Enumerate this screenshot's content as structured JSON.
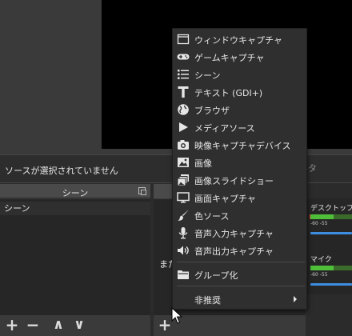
{
  "status_bar": {
    "no_source_text": "ソースが選択されていません",
    "filter_label": "ルタ"
  },
  "scenes_dock": {
    "title": "シーン",
    "items": [
      "シーン"
    ],
    "toolbar": {
      "add": "+",
      "remove": "−",
      "up": "∧",
      "down": "∨"
    }
  },
  "sources_dock": {
    "hint_text": "また",
    "toolbar": {
      "add": "+"
    }
  },
  "mixer": {
    "channels": [
      {
        "name": "デスクトップ音声",
        "ticks": "-60   -55",
        "level": 0.55
      },
      {
        "name": "マイク",
        "ticks": "-60   -55",
        "level": 0.55
      }
    ]
  },
  "context_menu": {
    "items": [
      {
        "label": "ウィンドウキャプチャ",
        "icon": "window-icon"
      },
      {
        "label": "ゲームキャプチャ",
        "icon": "gamepad-icon"
      },
      {
        "label": "シーン",
        "icon": "list-icon"
      },
      {
        "label": "テキスト (GDI+)",
        "icon": "text-icon"
      },
      {
        "label": "ブラウザ",
        "icon": "globe-icon"
      },
      {
        "label": "メディアソース",
        "icon": "play-icon"
      },
      {
        "label": "映像キャプチャデバイス",
        "icon": "camera-icon"
      },
      {
        "label": "画像",
        "icon": "image-icon"
      },
      {
        "label": "画像スライドショー",
        "icon": "slideshow-icon"
      },
      {
        "label": "画面キャプチャ",
        "icon": "monitor-icon"
      },
      {
        "label": "色ソース",
        "icon": "brush-icon"
      },
      {
        "label": "音声入力キャプチャ",
        "icon": "microphone-icon"
      },
      {
        "label": "音声出力キャプチャ",
        "icon": "speaker-icon"
      }
    ],
    "group_label": "グループ化",
    "deprecated_label": "非推奨"
  }
}
